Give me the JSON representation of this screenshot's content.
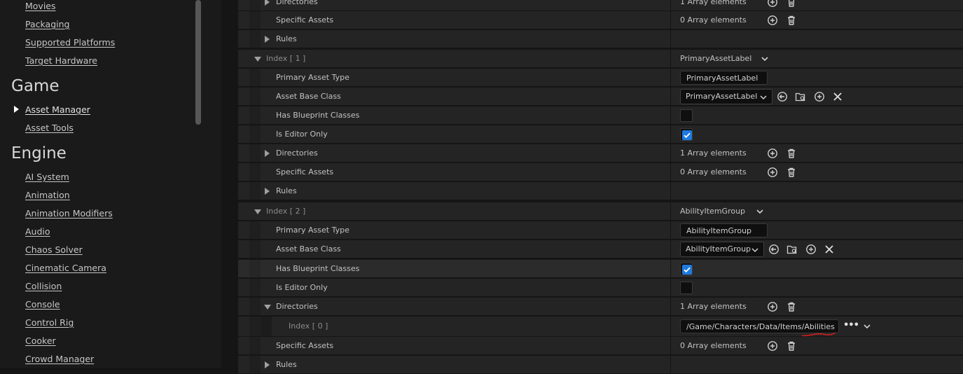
{
  "sidebar": {
    "top_items": [
      "Movies",
      "Packaging",
      "Supported Platforms",
      "Target Hardware"
    ],
    "game": {
      "title": "Game",
      "items": [
        {
          "label": "Asset Manager",
          "active": true
        },
        {
          "label": "Asset Tools",
          "active": false
        }
      ]
    },
    "engine": {
      "title": "Engine",
      "items": [
        "AI System",
        "Animation",
        "Animation Modifiers",
        "Audio",
        "Chaos Solver",
        "Cinematic Camera",
        "Collision",
        "Console",
        "Control Rig",
        "Cooker",
        "Crowd Manager"
      ]
    }
  },
  "details": {
    "labels": {
      "directories": "Directories",
      "specific_assets": "Specific Assets",
      "rules": "Rules",
      "primary_asset_type": "Primary Asset Type",
      "asset_base_class": "Asset Base Class",
      "has_blueprint_classes": "Has Blueprint Classes",
      "is_editor_only": "Is Editor Only"
    },
    "array_one": "1 Array elements",
    "array_zero": "0 Array elements",
    "index1": {
      "label": "Index [ 1 ]",
      "value": "PrimaryAssetLabel",
      "primary_asset_type": "PrimaryAssetLabel",
      "asset_base_class": "PrimaryAssetLabel",
      "has_blueprint_classes": false,
      "is_editor_only": true
    },
    "index2": {
      "label": "Index [ 2 ]",
      "value": "AbilityItemGroup",
      "primary_asset_type": "AbilityItemGroup",
      "asset_base_class": "AbilityItemGroup",
      "has_blueprint_classes": true,
      "is_editor_only": false,
      "directory_index_label": "Index [ 0 ]",
      "directory_path": "/Game/Characters/Data/Items/Abilities"
    }
  },
  "colors": {
    "checkbox_check": "#1e7ae0",
    "squiggle": "#d41c1c",
    "panel_bg": "#242424"
  },
  "icons": [
    "add-icon",
    "delete-icon",
    "reset-arrow-icon",
    "browse-folder-icon",
    "clear-icon",
    "ellipsis-icon",
    "chevron-down-icon",
    "expand-arrow-icon",
    "collapse-arrow-icon",
    "checkmark-icon"
  ]
}
